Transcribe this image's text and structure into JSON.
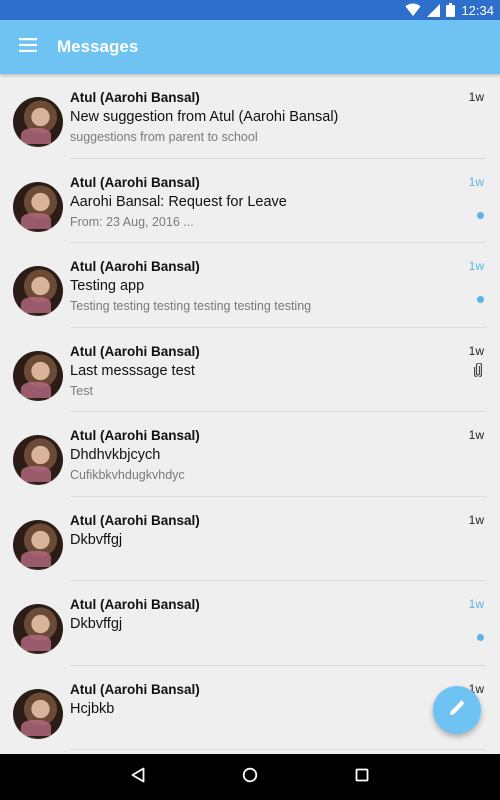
{
  "status_bar": {
    "time": "12:34",
    "icons": [
      "wifi-icon",
      "signal-icon",
      "battery-icon"
    ]
  },
  "app_bar": {
    "title": "Messages",
    "menu_icon": "menu-icon"
  },
  "colors": {
    "primary": "#6ec3f2",
    "status_bar": "#2f6fcc",
    "unread": "#5ab4ea"
  },
  "messages": [
    {
      "sender": "Atul (Aarohi  Bansal)",
      "subject": "New suggestion from Atul (Aarohi  Bansal)",
      "preview": "suggestions from parent to school",
      "time": "1w",
      "unread": false,
      "attachment": false
    },
    {
      "sender": "Atul (Aarohi  Bansal)",
      "subject": "Aarohi  Bansal: Request for Leave",
      "preview": "From: 23 Aug, 2016 ...",
      "time": "1w",
      "unread": true,
      "attachment": false
    },
    {
      "sender": "Atul (Aarohi  Bansal)",
      "subject": "Testing app",
      "preview": "Testing testing testing testing testing testing",
      "time": "1w",
      "unread": true,
      "attachment": false
    },
    {
      "sender": "Atul (Aarohi  Bansal)",
      "subject": "Last messsage test",
      "preview": "Test",
      "time": "1w",
      "unread": false,
      "attachment": true
    },
    {
      "sender": "Atul (Aarohi  Bansal)",
      "subject": "Dhdhvkbjcych",
      "preview": "Cufikbkvhdugkvhdyc",
      "time": "1w",
      "unread": false,
      "attachment": false
    },
    {
      "sender": "Atul (Aarohi  Bansal)",
      "subject": "Dkbvffgj",
      "preview": "",
      "time": "1w",
      "unread": false,
      "attachment": false
    },
    {
      "sender": "Atul (Aarohi  Bansal)",
      "subject": "Dkbvffgj",
      "preview": "",
      "time": "1w",
      "unread": true,
      "attachment": false
    },
    {
      "sender": "Atul (Aarohi  Bansal)",
      "subject": "Hcjbkb",
      "preview": "",
      "time": "1w",
      "unread": false,
      "attachment": false
    }
  ],
  "fab": {
    "icon": "pencil-icon"
  },
  "nav_bar": {
    "icons": [
      "back-icon",
      "home-icon",
      "recents-icon"
    ]
  }
}
